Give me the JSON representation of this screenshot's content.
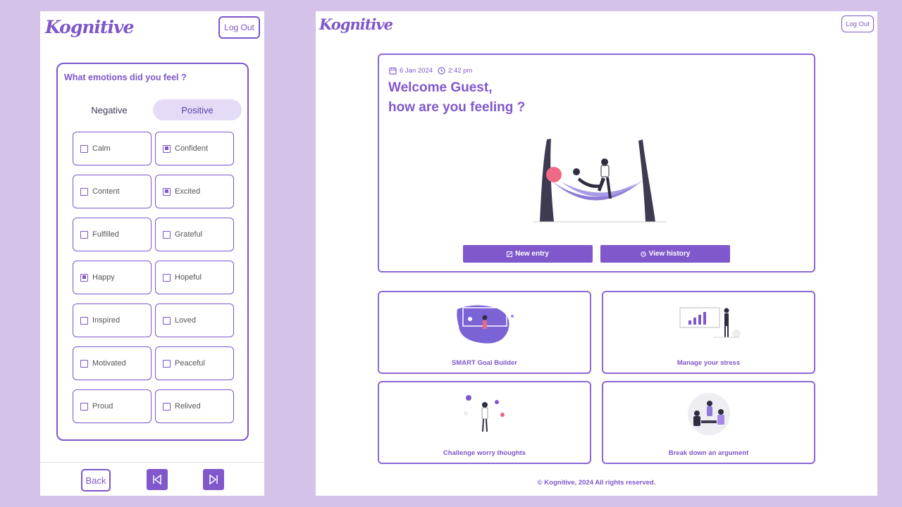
{
  "brand": {
    "name": "Kognitive",
    "logout_label": "Log Out"
  },
  "emotions": {
    "question": "What emotions did you feel ?",
    "tabs": [
      "Negative",
      "Positive"
    ],
    "active_tab": "Positive",
    "options": [
      {
        "label": "Calm",
        "checked": false
      },
      {
        "label": "Confident",
        "checked": true
      },
      {
        "label": "Content",
        "checked": false
      },
      {
        "label": "Excited",
        "checked": true
      },
      {
        "label": "Fulfilled",
        "checked": false
      },
      {
        "label": "Grateful",
        "checked": false
      },
      {
        "label": "Happy",
        "checked": true
      },
      {
        "label": "Hopeful",
        "checked": false
      },
      {
        "label": "Inspired",
        "checked": false
      },
      {
        "label": "Loved",
        "checked": false
      },
      {
        "label": "Motivated",
        "checked": false
      },
      {
        "label": "Peaceful",
        "checked": false
      },
      {
        "label": "Proud",
        "checked": false
      },
      {
        "label": "Relived",
        "checked": false
      }
    ]
  },
  "mobile_footer": {
    "back_label": "Back"
  },
  "dashboard": {
    "date": "6 Jan 2024",
    "time": "2:42 pm",
    "greeting_line1": "Welcome Guest,",
    "greeting_line2": "how are you feeling ?",
    "new_entry_label": "New entry",
    "view_history_label": "View history",
    "cards": [
      {
        "label": "SMART Goal Builder",
        "icon": "goal-illustration"
      },
      {
        "label": "Manage your stress",
        "icon": "chart-presentation-illustration"
      },
      {
        "label": "Challenge worry thoughts",
        "icon": "worry-illustration"
      },
      {
        "label": "Break down an argument",
        "icon": "argument-illustration"
      }
    ],
    "copyright": "© Kognitive, 2024 All rights reserved."
  },
  "colors": {
    "accent": "#8058cc",
    "background": "#d4c2e8",
    "tab_active": "#e6dbf6"
  }
}
